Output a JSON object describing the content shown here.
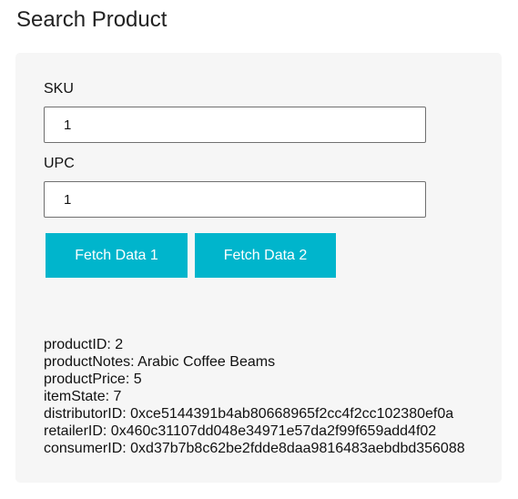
{
  "title": "Search Product",
  "form": {
    "sku_label": "SKU",
    "sku_value": "1",
    "upc_label": "UPC",
    "upc_value": "1",
    "fetch1_label": "Fetch Data 1",
    "fetch2_label": "Fetch Data 2"
  },
  "results": [
    "productID: 2",
    "productNotes: Arabic Coffee Beams",
    "productPrice: 5",
    "itemState: 7",
    "distributorID: 0xce5144391b4ab80668965f2cc4f2cc102380ef0a",
    "retailerID: 0x460c31107dd048e34971e57da2f99f659add4f02",
    "consumerID: 0xd37b7b8c62be2fdde8daa9816483aebdbd356088"
  ],
  "colors": {
    "button": "#00b5cc",
    "panel": "#f6f6f6"
  }
}
